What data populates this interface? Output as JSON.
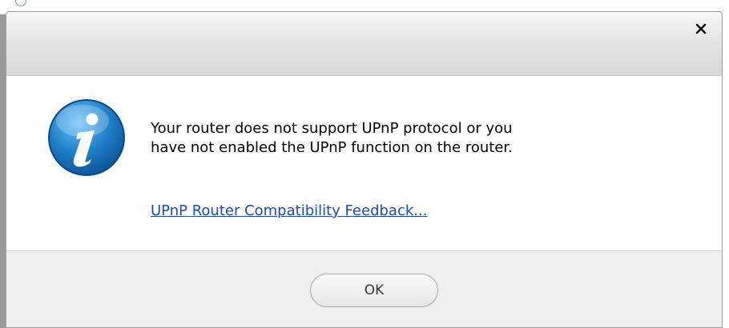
{
  "dialog": {
    "message": [
      "Your router does not support UPnP protocol or you",
      "have not enabled the UPnP function on the router."
    ],
    "link_label": "UPnP Router Compatibility Feedback...",
    "ok_label": "OK",
    "close_symbol": "×",
    "icon": "info-icon"
  },
  "colors": {
    "link": "#1a4bb8",
    "icon_blue": "#1e7fc7",
    "footer": "#efefef"
  }
}
